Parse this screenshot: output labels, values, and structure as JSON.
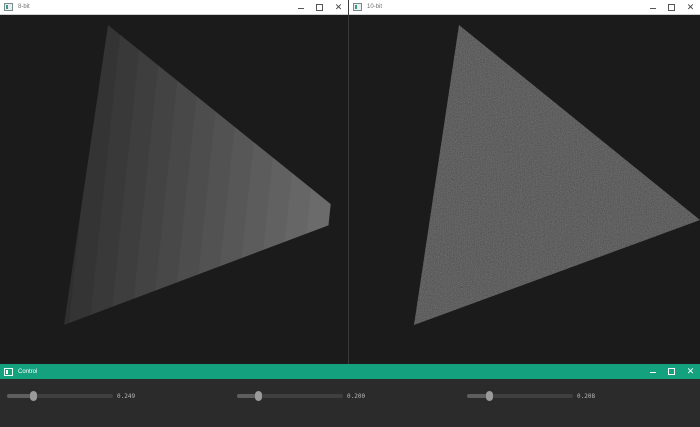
{
  "windows": {
    "left": {
      "title": "8-bit"
    },
    "right": {
      "title": "10-bit"
    },
    "control": {
      "title": "Control"
    }
  },
  "controls": {
    "minimize": "—",
    "maximize": "☐",
    "close": "✕"
  },
  "sliders": [
    {
      "value_text": "0.249",
      "value": 0.249
    },
    {
      "value_text": "0.200",
      "value": 0.2
    },
    {
      "value_text": "0.208",
      "value": 0.208
    }
  ],
  "colors": {
    "control_accent": "#13a17e",
    "canvas_bg": "#1b1b1b",
    "banded_light": "#696969",
    "banded_dark": "#2a2a2a",
    "dither_base": "#444444"
  },
  "icons": [
    "app-icon",
    "minimize-icon",
    "maximize-icon",
    "close-icon"
  ]
}
